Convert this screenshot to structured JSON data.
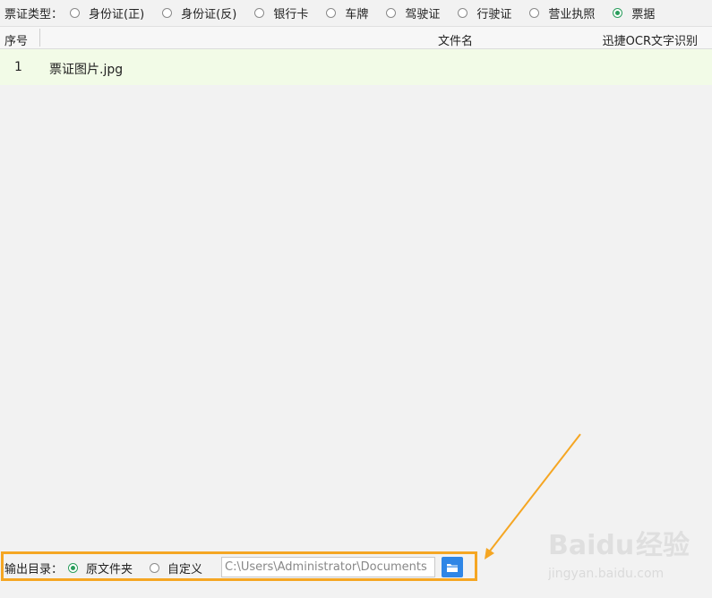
{
  "ticket_type": {
    "label": "票证类型：",
    "options": [
      {
        "label": "身份证(正)",
        "checked": false
      },
      {
        "label": "身份证(反)",
        "checked": false
      },
      {
        "label": "银行卡",
        "checked": false
      },
      {
        "label": "车牌",
        "checked": false
      },
      {
        "label": "驾驶证",
        "checked": false
      },
      {
        "label": "行驶证",
        "checked": false
      },
      {
        "label": "营业执照",
        "checked": false
      },
      {
        "label": "票据",
        "checked": true
      }
    ]
  },
  "table": {
    "headers": {
      "index": "序号",
      "filename": "文件名",
      "ocr": "迅捷OCR文字识别"
    },
    "rows": [
      {
        "index": "1",
        "filename": "票证图片.jpg"
      }
    ]
  },
  "output": {
    "label": "输出目录：",
    "options": [
      {
        "label": "原文件夹",
        "checked": true
      },
      {
        "label": "自定义",
        "checked": false
      }
    ],
    "path_value": "C:\\Users\\Administrator\\Documents"
  },
  "watermark": {
    "brand": "Baidu",
    "brand_cn": "经验",
    "url": "jingyan.baidu.com"
  },
  "colors": {
    "accent_green": "#2a9d5c",
    "highlight_orange": "#f5a623",
    "button_blue": "#2f86e6",
    "row_bg": "#f2fbe7"
  }
}
